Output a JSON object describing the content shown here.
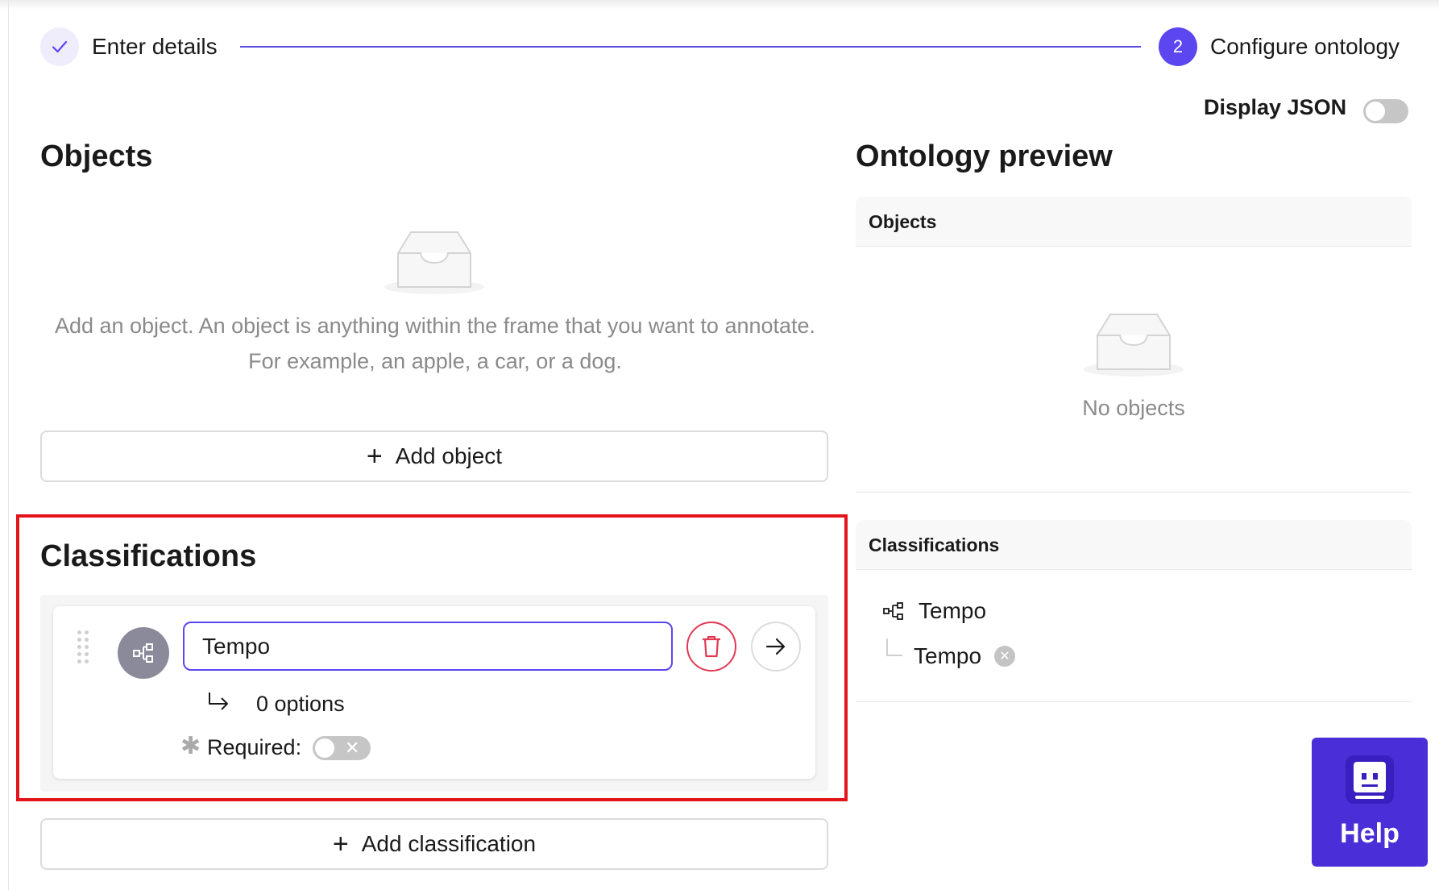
{
  "stepper": {
    "step1": {
      "label": "Enter details"
    },
    "step2": {
      "number": "2",
      "label": "Configure ontology"
    }
  },
  "display_json": {
    "label": "Display JSON",
    "enabled": false
  },
  "objects": {
    "title": "Objects",
    "empty_text": "Add an object. An object is anything within the frame that you want to annotate. For example, an apple, a car, or a dog.",
    "add_label": "Add object"
  },
  "classifications": {
    "title": "Classifications",
    "items": [
      {
        "name": "Tempo",
        "type_icon": "radio-tree-icon",
        "options_count": "0 options",
        "required_label": "Required:",
        "required": false
      }
    ],
    "add_label": "Add classification"
  },
  "preview": {
    "title": "Ontology preview",
    "objects_header": "Objects",
    "objects_empty": "No objects",
    "classifications_header": "Classifications",
    "classification_name": "Tempo",
    "option_name": "Tempo"
  },
  "help": {
    "label": "Help"
  }
}
